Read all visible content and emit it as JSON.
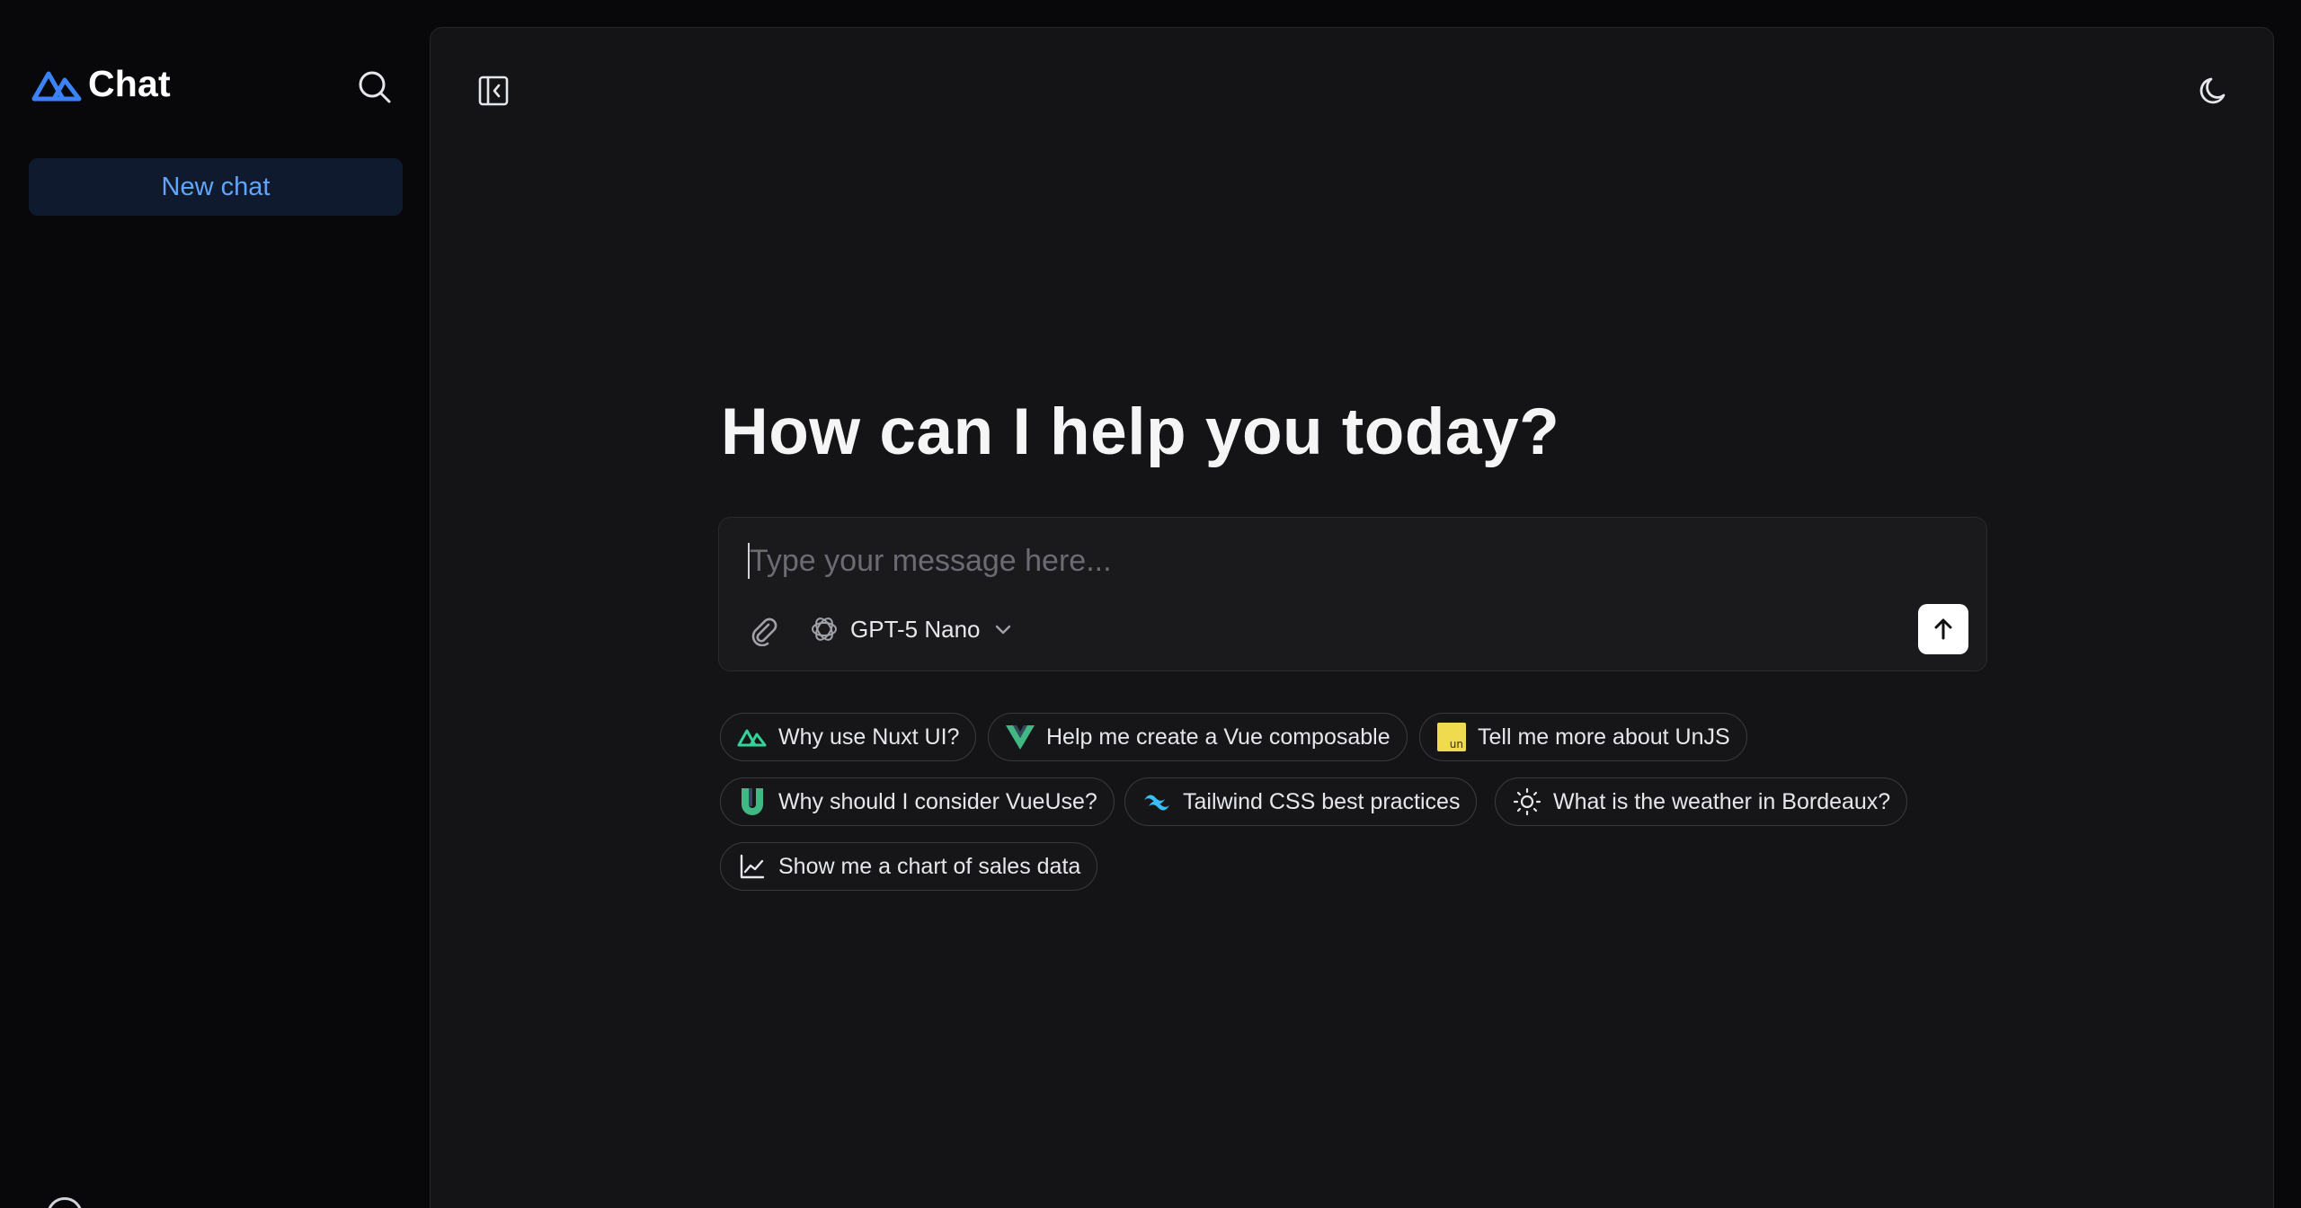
{
  "sidebar": {
    "brand": "Chat",
    "new_chat_label": "New chat"
  },
  "main": {
    "headline": "How can I help you today?",
    "composer": {
      "placeholder": "Type your message here...",
      "value": "",
      "model": "GPT-5 Nano"
    },
    "suggestions": [
      {
        "label": "Why use Nuxt UI?",
        "icon": "nuxt-icon"
      },
      {
        "label": "Help me create a Vue composable",
        "icon": "vue-icon"
      },
      {
        "label": "Tell me more about UnJS",
        "icon": "unjs-icon"
      },
      {
        "label": "Why should I consider VueUse?",
        "icon": "vueuse-icon"
      },
      {
        "label": "Tailwind CSS best practices",
        "icon": "tailwind-icon"
      },
      {
        "label": "What is the weather in Bordeaux?",
        "icon": "sun-icon"
      },
      {
        "label": "Show me a chart of sales data",
        "icon": "chart-icon"
      }
    ]
  },
  "colors": {
    "accent": "#60a5fa",
    "brand_logo": "#3b82f6",
    "background": "#08080b",
    "panel": "#141417"
  },
  "icons": [
    "search-icon",
    "sidebar-collapse-icon",
    "moon-icon",
    "paperclip-icon",
    "openai-icon",
    "chevron-down-icon",
    "arrow-up-icon"
  ]
}
